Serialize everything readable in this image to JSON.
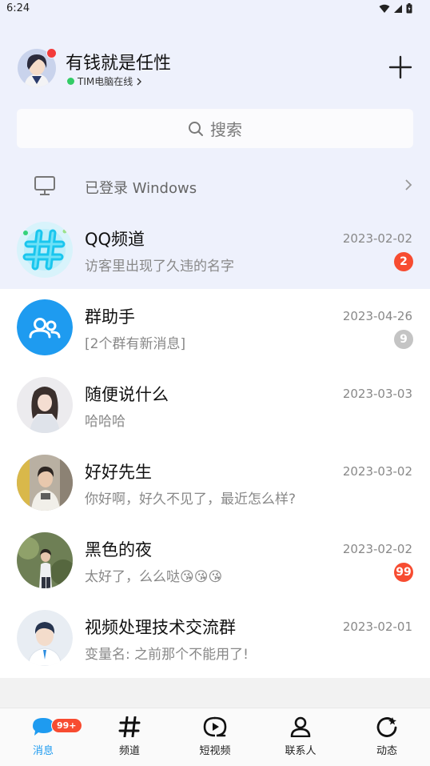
{
  "status": {
    "time": "6:24"
  },
  "header": {
    "nickname": "有钱就是任性",
    "online_status": "TIM电脑在线"
  },
  "search": {
    "label": "搜索"
  },
  "device_login": {
    "label": "已登录 Windows"
  },
  "chats": [
    {
      "name": "QQ频道",
      "message": "访客里出现了久违的名字",
      "date": "2023-02-02",
      "badge": "2",
      "badge_style": "red"
    },
    {
      "name": "群助手",
      "message": "[2个群有新消息]",
      "date": "2023-04-26",
      "badge": "9",
      "badge_style": "gray"
    },
    {
      "name": "随便说什么",
      "message": "哈哈哈",
      "date": "2023-03-03",
      "badge": "",
      "badge_style": ""
    },
    {
      "name": "好好先生",
      "message": "你好啊，好久不见了，最近怎么样?",
      "date": "2023-03-02",
      "badge": "",
      "badge_style": ""
    },
    {
      "name": "黑色的夜",
      "message": "太好了，么么哒😘😘😘",
      "date": "2023-02-02",
      "badge": "99",
      "badge_style": "red"
    },
    {
      "name": "视频处理技术交流群",
      "message": "变量名: 之前那个不能用了!",
      "date": "2023-02-01",
      "badge": "",
      "badge_style": ""
    }
  ],
  "tabs": [
    {
      "label": "消息",
      "badge": "99+"
    },
    {
      "label": "频道"
    },
    {
      "label": "短视频"
    },
    {
      "label": "联系人"
    },
    {
      "label": "动态"
    }
  ],
  "colors": {
    "accent": "#1e9bf0",
    "badge_red": "#f74c31",
    "header_bg": "#eef1fc"
  }
}
